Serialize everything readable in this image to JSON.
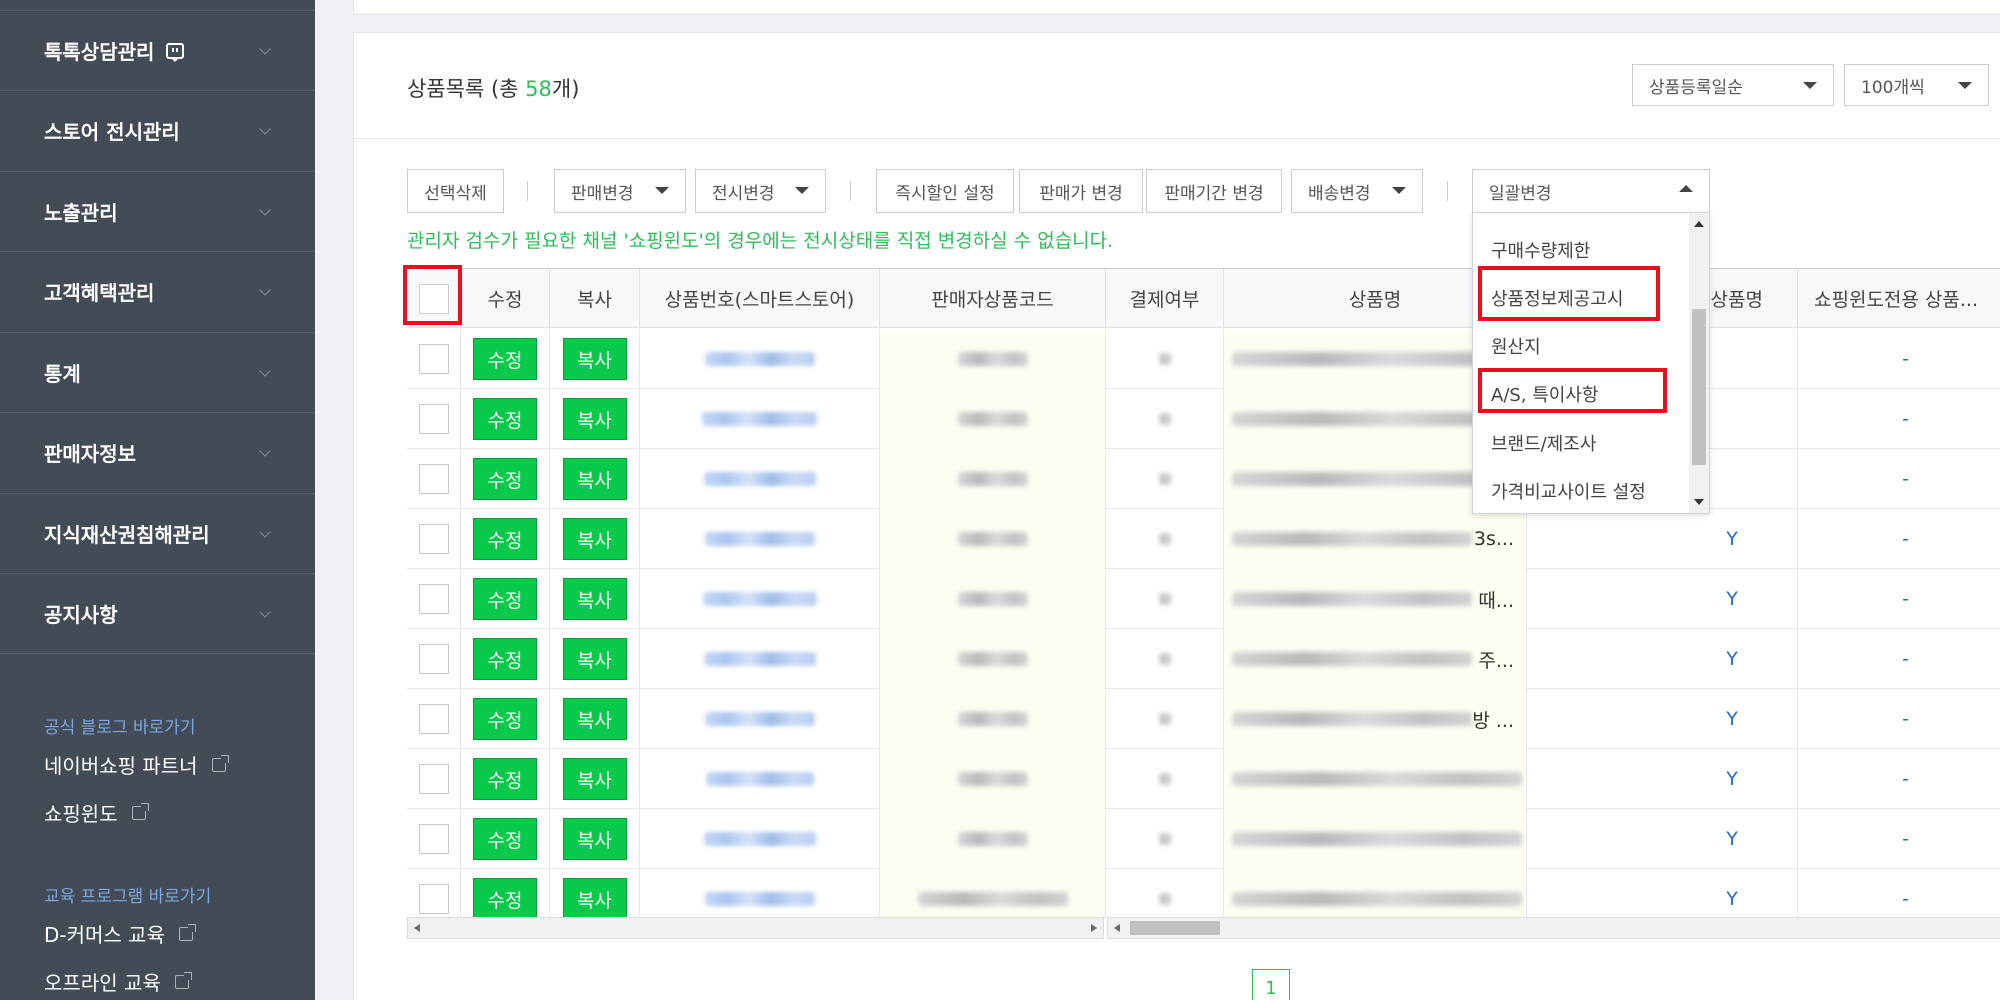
{
  "sidebar": {
    "items": [
      {
        "label": "톡톡상담관리"
      },
      {
        "label": "스토어 전시관리"
      },
      {
        "label": "노출관리"
      },
      {
        "label": "고객혜택관리"
      },
      {
        "label": "통계"
      },
      {
        "label": "판매자정보"
      },
      {
        "label": "지식재산권침해관리"
      },
      {
        "label": "공지사항"
      }
    ],
    "blog_heading": "공식 블로그 바로가기",
    "blog_links": [
      "네이버쇼핑 파트너",
      "쇼핑윈도"
    ],
    "edu_heading": "교육 프로그램 바로가기",
    "edu_links": [
      "D-커머스 교육",
      "오프라인 교육"
    ]
  },
  "list": {
    "title_prefix": "상품목록 (총 ",
    "count": "58",
    "title_suffix": "개)",
    "sort_select": "상품등록일순",
    "page_size_select": "100개씩"
  },
  "toolbar": {
    "delete_selected": "선택삭제",
    "sale_change": "판매변경",
    "display_change": "전시변경",
    "instant_discount": "즉시할인 설정",
    "price_change": "판매가 변경",
    "period_change": "판매기간 변경",
    "shipping_change": "배송변경",
    "bulk_change": "일괄변경"
  },
  "notice": "관리자 검수가 필요한 채널 '쇼핑윈도'의 경우에는 전시상태를 직접 변경하실 수 없습니다.",
  "bulk_options": [
    "구매수량제한",
    "상품정보제공고시",
    "원산지",
    "A/S, 특이사항",
    "브랜드/제조사",
    "가격비교사이트 설정"
  ],
  "table": {
    "headers": [
      "수정",
      "복사",
      "상품번호(스마트스토어)",
      "판매자상품코드",
      "결제여부",
      "상품명",
      "상품명",
      "쇼핑윈도전용 상품..."
    ],
    "edit_label": "수정",
    "copy_label": "복사",
    "rows": [
      {
        "name_tail": "",
        "flag": "",
        "window": "-"
      },
      {
        "name_tail": "",
        "flag": "",
        "window": "-"
      },
      {
        "name_tail": "",
        "flag": "",
        "window": "-"
      },
      {
        "name_tail": "3s...",
        "flag": "Y",
        "window": "-"
      },
      {
        "name_tail": "때...",
        "flag": "Y",
        "window": "-"
      },
      {
        "name_tail": "주...",
        "flag": "Y",
        "window": "-"
      },
      {
        "name_tail": "방 ...",
        "flag": "Y",
        "window": "-"
      },
      {
        "name_tail": "",
        "flag": "Y",
        "window": "-"
      },
      {
        "name_tail": "",
        "flag": "Y",
        "window": "-"
      },
      {
        "name_tail": "",
        "flag": "Y",
        "window": "-"
      }
    ]
  },
  "pagination": {
    "current": "1"
  },
  "colors": {
    "accent_green": "#2ebd59",
    "button_green": "#08c94a",
    "highlight_red": "#e8101e",
    "sidebar_bg": "#434b57"
  }
}
